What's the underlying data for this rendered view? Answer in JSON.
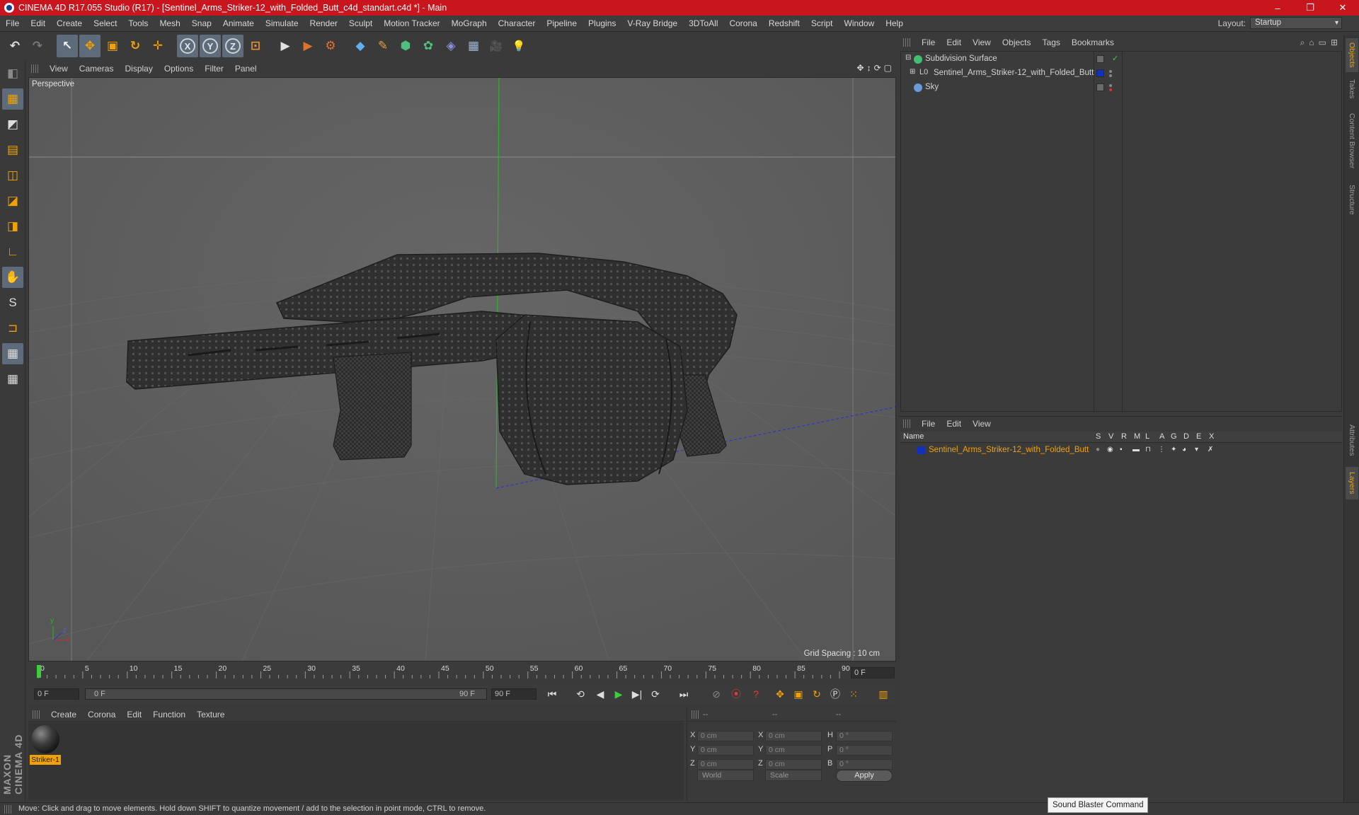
{
  "window": {
    "title": "CINEMA 4D R17.055 Studio (R17) - [Sentinel_Arms_Striker-12_with_Folded_Butt_c4d_standart.c4d *] - Main",
    "minimize": "–",
    "maximize": "❐",
    "close": "✕"
  },
  "menubar": {
    "items": [
      "File",
      "Edit",
      "Create",
      "Select",
      "Tools",
      "Mesh",
      "Snap",
      "Animate",
      "Simulate",
      "Render",
      "Sculpt",
      "Motion Tracker",
      "MoGraph",
      "Character",
      "Pipeline",
      "Plugins",
      "V-Ray Bridge",
      "3DToAll",
      "Corona",
      "Redshift",
      "Script",
      "Window",
      "Help"
    ],
    "layout_label": "Layout:",
    "layout_value": "Startup"
  },
  "toolbar": {
    "undo": "↶",
    "redo": "↷",
    "select": "↖",
    "move": "✥",
    "scale": "▣",
    "rotate": "↻",
    "last": "✛",
    "x": "X",
    "y": "Y",
    "z": "Z",
    "coord": "⊡",
    "render_view": "▶",
    "render_pic": "▶",
    "render_settings": "⚙",
    "cube": "◆",
    "pen": "✎",
    "subdiv": "⬢",
    "cloner": "✿",
    "deform": "◈",
    "floor": "▦",
    "camera": "🎥",
    "light": "💡"
  },
  "lefttools": [
    "◧",
    "▦",
    "◩",
    "▤",
    "◫",
    "◪",
    "◨",
    "∟",
    "✋",
    "S",
    "⊐",
    "▦",
    "▦"
  ],
  "viewport": {
    "menu": [
      "View",
      "Cameras",
      "Display",
      "Options",
      "Filter",
      "Panel"
    ],
    "nav_icons": [
      "✥",
      "↕",
      "⟳",
      "▢"
    ],
    "label": "Perspective",
    "grid_spacing": "Grid Spacing : 10 cm",
    "axis_x": "x",
    "axis_y": "y",
    "axis_z": "z"
  },
  "timeline": {
    "ticks": [
      "0",
      "5",
      "10",
      "15",
      "20",
      "25",
      "30",
      "35",
      "40",
      "45",
      "50",
      "55",
      "60",
      "65",
      "70",
      "75",
      "80",
      "85",
      "90"
    ],
    "current_frame": "0 F",
    "start_field": "0 F",
    "range_start": "0 F",
    "range_end": "90 F",
    "end_field": "90 F",
    "transport": [
      "⏮",
      "⟲",
      "◀",
      "▶",
      "▶|",
      "⟳",
      "⏭"
    ]
  },
  "materials": {
    "menu": [
      "Create",
      "Corona",
      "Edit",
      "Function",
      "Texture"
    ],
    "items": [
      {
        "name": "Striker-1"
      }
    ]
  },
  "coordinates": {
    "header": [
      "--",
      "--",
      "--"
    ],
    "rows": [
      {
        "a": "X",
        "av": "0 cm",
        "b": "X",
        "bv": "0 cm",
        "c": "H",
        "cv": "0 °"
      },
      {
        "a": "Y",
        "av": "0 cm",
        "b": "Y",
        "bv": "0 cm",
        "c": "P",
        "cv": "0 °"
      },
      {
        "a": "Z",
        "av": "0 cm",
        "b": "Z",
        "bv": "0 cm",
        "c": "B",
        "cv": "0 °"
      }
    ],
    "world": "World",
    "scale": "Scale",
    "apply": "Apply"
  },
  "objects": {
    "menu": [
      "File",
      "Edit",
      "View",
      "Objects",
      "Tags",
      "Bookmarks"
    ],
    "items": [
      {
        "name": "Subdivision Surface",
        "color": "#3fbf6f"
      },
      {
        "name": "Sentinel_Arms_Striker-12_with_Folded_Butt",
        "color": "#aaaaaa"
      },
      {
        "name": "Sky",
        "color": "#6a9bd8"
      }
    ]
  },
  "layers": {
    "menu": [
      "File",
      "Edit",
      "View"
    ],
    "columns": [
      "Name",
      "S",
      "V",
      "R",
      "M",
      "L",
      "A",
      "G",
      "D",
      "E",
      "X"
    ],
    "items": [
      {
        "name": "Sentinel_Arms_Striker-12_with_Folded_Butt",
        "color": "#1530b8"
      }
    ]
  },
  "side_tabs": [
    "Objects",
    "Takes",
    "Content Browser",
    "Structure",
    "Attributes",
    "Layers"
  ],
  "status": {
    "text": "Move: Click and drag to move elements. Hold down SHIFT to quantize movement / add to the selection in point mode, CTRL to remove.",
    "tooltip": "Sound Blaster Command",
    "maxon": "MAXON CINEMA 4D"
  },
  "colors": {
    "titlebar": "#c9151e",
    "accent": "#f2a200",
    "viewport_bg": "#595959"
  }
}
